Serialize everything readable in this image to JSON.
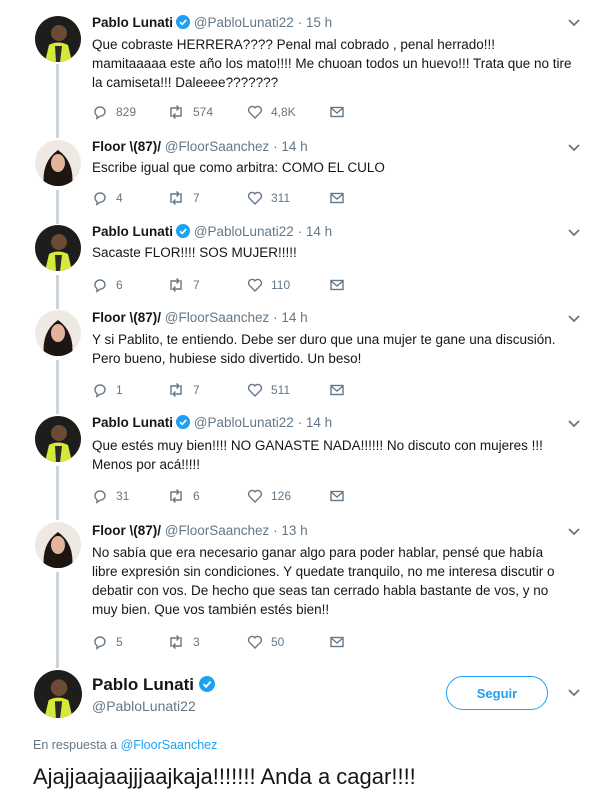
{
  "tweets": [
    {
      "name": "Pablo Lunati",
      "handle": "@PabloLunati22",
      "time": "15 h",
      "verified": true,
      "text": "Que cobraste HERRERA???? Penal mal cobrado , penal herrado!!! mamitaaaaa este año los mato!!!! Me chuoan todos un huevo!!! Trata que no tire la camiseta!!! Daleeee???????",
      "replies": "829",
      "retweets": "574",
      "likes": "4,8K"
    },
    {
      "name": "Floor \\(87)/",
      "handle": "@FloorSaanchez",
      "time": "14 h",
      "verified": false,
      "text": "Escribe igual que como arbitra: COMO EL CULO",
      "replies": "4",
      "retweets": "7",
      "likes": "311"
    },
    {
      "name": "Pablo Lunati",
      "handle": "@PabloLunati22",
      "time": "14 h",
      "verified": true,
      "text": "Sacaste FLOR!!!! SOS MUJER!!!!!",
      "replies": "6",
      "retweets": "7",
      "likes": "110"
    },
    {
      "name": "Floor \\(87)/",
      "handle": "@FloorSaanchez",
      "time": "14 h",
      "verified": false,
      "text": "Y si Pablito, te entiendo. Debe ser duro que una mujer te gane una discusión. Pero bueno, hubiese sido divertido. Un beso!",
      "replies": "1",
      "retweets": "7",
      "likes": "511"
    },
    {
      "name": "Pablo Lunati",
      "handle": "@PabloLunati22",
      "time": "14 h",
      "verified": true,
      "text": "Que estés muy bien!!!! NO GANASTE NADA!!!!!! No discuto con mujeres !!! Menos por acá!!!!!",
      "replies": "31",
      "retweets": "6",
      "likes": "126"
    },
    {
      "name": "Floor \\(87)/",
      "handle": "@FloorSaanchez",
      "time": "13 h",
      "verified": false,
      "text": "No sabía que era necesario ganar algo para poder hablar, pensé que había libre expresión sin condiciones. Y quedate tranquilo, no me interesa discutir o debatir con vos. De hecho que seas tan cerrado habla bastante de vos, y no muy bien. Que vos también estés bien!!",
      "replies": "5",
      "retweets": "3",
      "likes": "50"
    }
  ],
  "main_tweet": {
    "name": "Pablo Lunati",
    "handle": "@PabloLunati22",
    "follow_label": "Seguir",
    "reply_prefix": "En respuesta a",
    "reply_mention": "@FloorSaanchez",
    "text": "Ajajjaajaajjjaajkaja!!!!!!! Anda a cagar!!!!"
  },
  "colors": {
    "accent": "#1da1f2",
    "muted": "#657786",
    "text": "#14171a",
    "thread_line": "#cdd6dd"
  }
}
